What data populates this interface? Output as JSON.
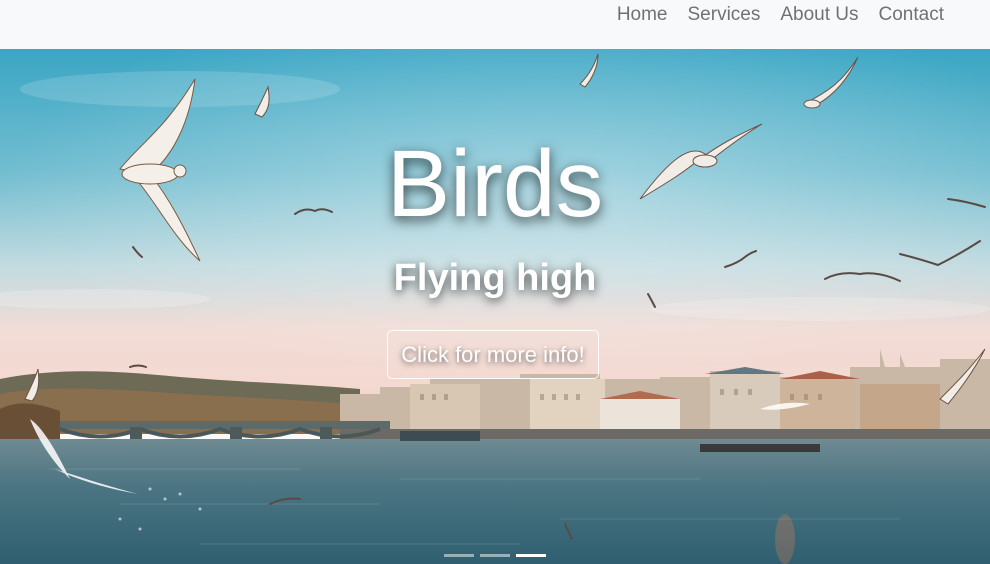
{
  "nav": {
    "items": [
      {
        "label": "Home"
      },
      {
        "label": "Services"
      },
      {
        "label": "About Us"
      },
      {
        "label": "Contact"
      }
    ]
  },
  "carousel": {
    "title": "Birds",
    "subtitle": "Flying high",
    "button_label": "Click for more info!",
    "slide_count": 3,
    "active_slide": 3
  },
  "colors": {
    "navbar_bg": "#f8f9fa",
    "nav_link": "#7a7a7a",
    "sky_top": "#3aa6c4",
    "sky_horizon": "#f1dcd6",
    "water": "#3f6b7a"
  }
}
